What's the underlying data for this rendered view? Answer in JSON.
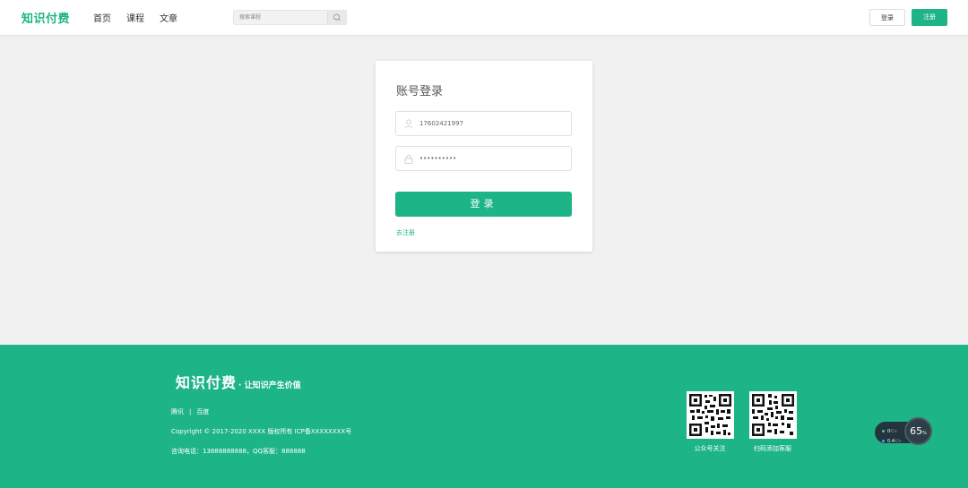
{
  "header": {
    "logo": "知识付费",
    "nav": [
      "首页",
      "课程",
      "文章"
    ],
    "search_placeholder": "搜索课程",
    "search_icon": "search-icon",
    "login_label": "登录",
    "register_label": "注册"
  },
  "login": {
    "title": "账号登录",
    "username_value": "17602421997",
    "password_value": "••••••••••",
    "user_icon": "user-icon",
    "lock_icon": "lock-icon",
    "submit_label": "登录",
    "register_link": "去注册"
  },
  "footer": {
    "brand": "知识付费",
    "slogan": "· 让知识产生价值",
    "links": [
      "腾讯",
      "百度"
    ],
    "link_separator": "|",
    "copyright": "Copyright © 2017-2020 XXXX 版权所有 ICP备XXXXXXXX号",
    "contact": "咨询电话：13888888888，QQ客服：888888",
    "qr1_caption": "公众号关注",
    "qr2_caption": "扫码添加客服"
  },
  "net_widget": {
    "up_value": "0",
    "up_unit": "K/s",
    "down_value": "0.4",
    "down_unit": "K/s",
    "percent": "65",
    "percent_unit": "%"
  },
  "colors": {
    "brand": "#1db487",
    "background": "#f1f1f1",
    "footer": "#1db487"
  }
}
